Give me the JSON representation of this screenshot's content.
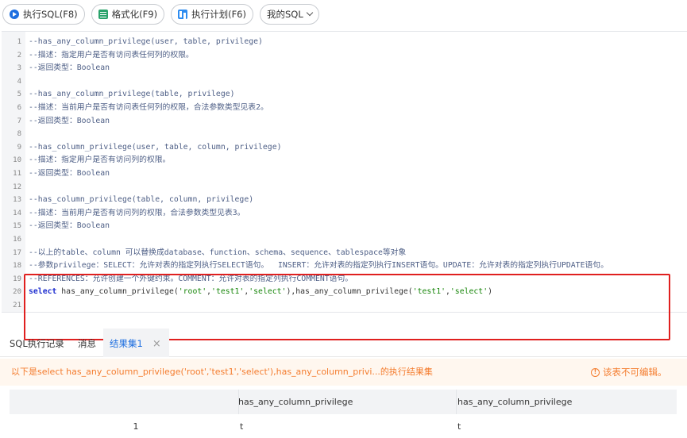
{
  "toolbar": {
    "run_label": "执行SQL(F8)",
    "format_label": "格式化(F9)",
    "plan_label": "执行计划(F6)",
    "mysql_label": "我的SQL"
  },
  "editor": {
    "lines": [
      {
        "num": "1",
        "text": "--has_any_column_privilege(user, table, privilege)"
      },
      {
        "num": "2",
        "text": "--描述：指定用户是否有访问表任何列的权限。"
      },
      {
        "num": "3",
        "text": "--返回类型：Boolean"
      },
      {
        "num": "4",
        "text": ""
      },
      {
        "num": "5",
        "text": "--has_any_column_privilege(table, privilege)"
      },
      {
        "num": "6",
        "text": "--描述：当前用户是否有访问表任何列的权限，合法参数类型见表2。"
      },
      {
        "num": "7",
        "text": "--返回类型：Boolean"
      },
      {
        "num": "8",
        "text": ""
      },
      {
        "num": "9",
        "text": "--has_column_privilege(user, table, column, privilege)"
      },
      {
        "num": "10",
        "text": "--描述：指定用户是否有访问列的权限。"
      },
      {
        "num": "11",
        "text": "--返回类型：Boolean"
      },
      {
        "num": "12",
        "text": ""
      },
      {
        "num": "13",
        "text": "--has_column_privilege(table, column, privilege)"
      },
      {
        "num": "14",
        "text": "--描述：当前用户是否有访问列的权限，合法参数类型见表3。"
      },
      {
        "num": "15",
        "text": "--返回类型：Boolean"
      },
      {
        "num": "16",
        "text": ""
      },
      {
        "num": "17",
        "text": "--以上的table、column 可以替换成database、function、schema、sequence、tablespace等对象"
      },
      {
        "num": "18",
        "text": "--参数privilege：SELECT：允许对表的指定列执行SELECT语句。  INSERT：允许对表的指定列执行INSERT语句。UPDATE：允许对表的指定列执行UPDATE语句。"
      },
      {
        "num": "19",
        "text": "--REFERENCES：允许创建一个外键约束。COMMENT：允许对表的指定列执行COMMENT语句。"
      },
      {
        "num": "20",
        "sql": {
          "kw": "select",
          "p1": " has_any_column_privilege(",
          "s1": "'root'",
          "c1": ",",
          "s2": "'test1'",
          "c2": ",",
          "s3": "'select'",
          "p2": "),has_any_column_privilege(",
          "s4": "'test1'",
          "c3": ",",
          "s5": "'select'",
          "p3": ")"
        }
      },
      {
        "num": "21",
        "text": ""
      }
    ]
  },
  "results": {
    "tabs": [
      "SQL执行记录",
      "消息",
      "结果集1"
    ],
    "close_icon": "×",
    "notice": "以下是select has_any_column_privilege('root','test1','select'),has_any_column_privi...的执行结果集",
    "readonly": "该表不可编辑。",
    "columns": [
      "",
      "has_any_column_privilege",
      "has_any_column_privilege"
    ],
    "rows": [
      [
        "1",
        "t",
        "t"
      ]
    ]
  },
  "colors": {
    "accent": "#1e6fe0",
    "highlight_border": "#e0201f",
    "notice_text": "#f47c2e"
  }
}
